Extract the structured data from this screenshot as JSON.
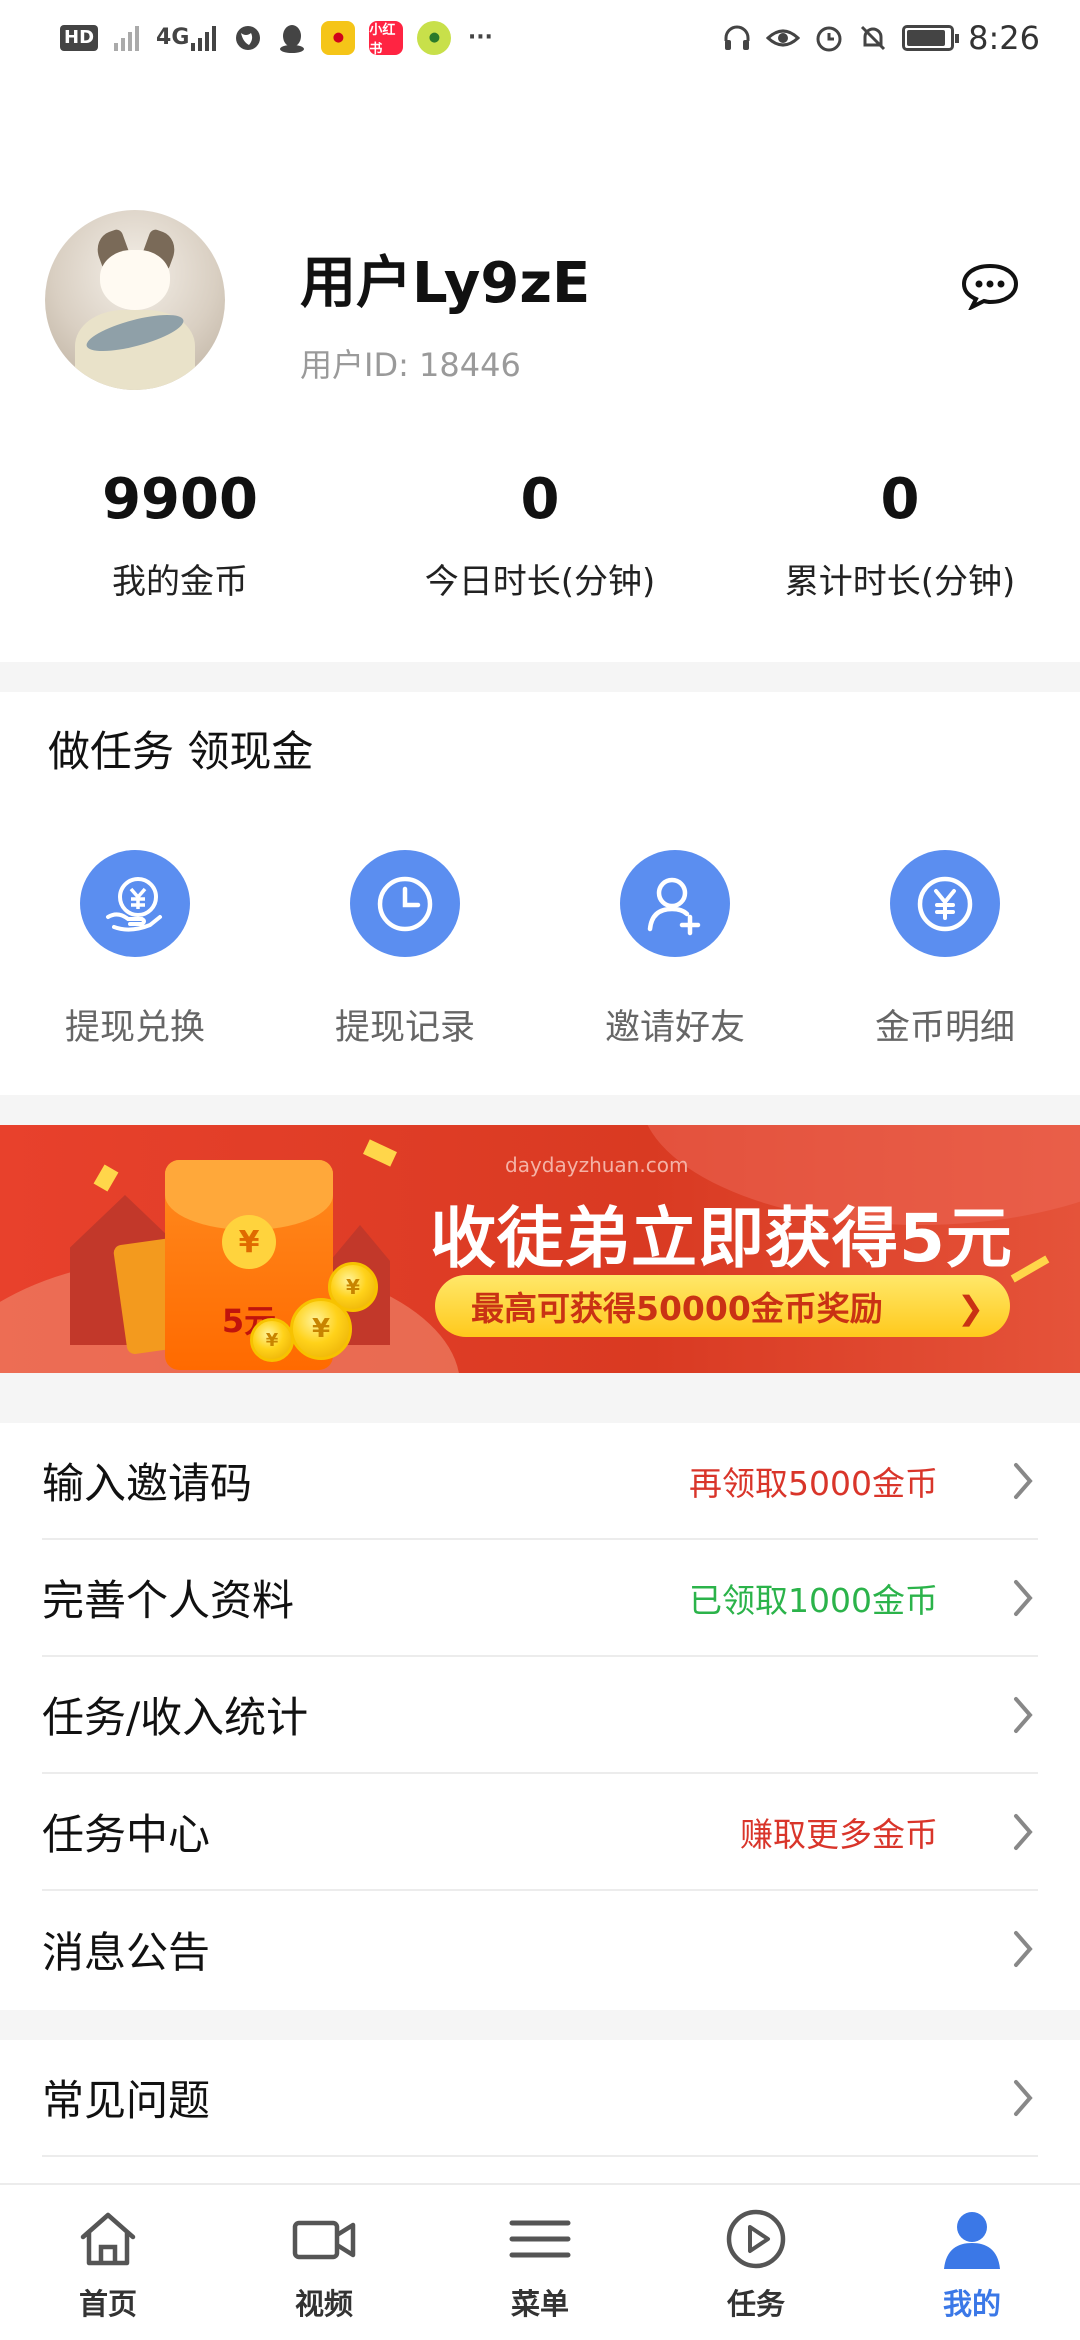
{
  "status_bar": {
    "network": "4G",
    "time": "8:26",
    "battery_level": 0.9,
    "notification_icons": [
      "hd-icon",
      "signal-icon",
      "signal-4g-icon",
      "globe-icon",
      "qq-icon",
      "weibo-icon",
      "xiaohongshu-icon",
      "lime-app-icon",
      "more-dots-icon"
    ],
    "system_icons": [
      "headset-icon",
      "eye-icon",
      "alarm-icon",
      "mute-icon",
      "battery-icon"
    ],
    "more": "···",
    "xhs_text": "小红书"
  },
  "profile": {
    "username": "用户Ly9zE",
    "user_id": "用户ID: 18446",
    "message_icon": "chat-bubble-icon"
  },
  "stats": [
    {
      "value": "9900",
      "label": "我的金币"
    },
    {
      "value": "0",
      "label": "今日时长(分钟)"
    },
    {
      "value": "0",
      "label": "累计时长(分钟)"
    }
  ],
  "tasks": {
    "title": "做任务 领现金",
    "items": [
      {
        "label": "提现兑换",
        "icon": "yen-hand-icon"
      },
      {
        "label": "提现记录",
        "icon": "clock-icon"
      },
      {
        "label": "邀请好友",
        "icon": "add-user-icon"
      },
      {
        "label": "金币明细",
        "icon": "yen-coin-icon"
      }
    ]
  },
  "banner": {
    "site": "daydayzhuan.com",
    "headline": "收徒弟立即获得5元",
    "subline": "最高可获得50000金币奖励",
    "envelope_amount": "5元",
    "yen": "¥"
  },
  "menu": {
    "group1": [
      {
        "label": "输入邀请码",
        "note": "再领取5000金币",
        "note_color": "#d9352a"
      },
      {
        "label": "完善个人资料",
        "note": "已领取1000金币",
        "note_color": "#2bb34a"
      },
      {
        "label": "任务/收入统计",
        "note": ""
      },
      {
        "label": "任务中心",
        "note": "赚取更多金币",
        "note_color": "#d9352a"
      },
      {
        "label": "消息公告",
        "note": ""
      }
    ],
    "group2": [
      {
        "label": "常见问题",
        "note": ""
      }
    ]
  },
  "tabbar": {
    "active_color": "#3b78e7",
    "items": [
      {
        "label": "首页",
        "icon": "home-icon"
      },
      {
        "label": "视频",
        "icon": "video-camera-icon"
      },
      {
        "label": "菜单",
        "icon": "menu-icon"
      },
      {
        "label": "任务",
        "icon": "play-circle-icon"
      },
      {
        "label": "我的",
        "icon": "user-icon",
        "active": true
      }
    ]
  }
}
